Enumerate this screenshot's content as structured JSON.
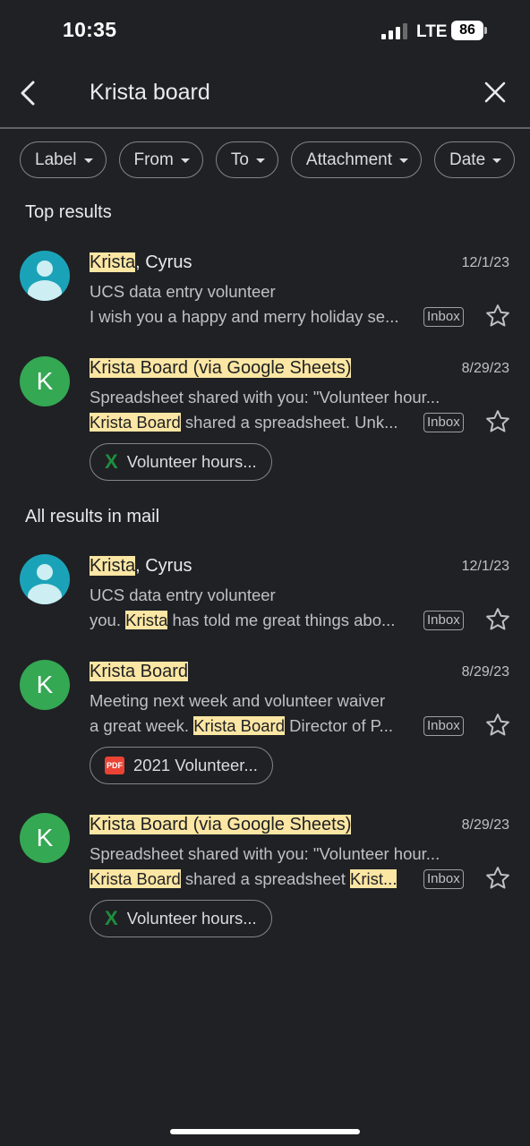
{
  "status_bar": {
    "time": "10:35",
    "network": "LTE",
    "battery": "86"
  },
  "search": {
    "query": "Krista board"
  },
  "filters": [
    "Label",
    "From",
    "To",
    "Attachment",
    "Date"
  ],
  "sections": {
    "top": "Top results",
    "all": "All results in mail"
  },
  "badge_label": "Inbox",
  "emails": [
    {
      "avatar": "person-icon",
      "sender": [
        {
          "t": "Krista",
          "h": true
        },
        {
          "t": ", Cyrus",
          "h": false
        }
      ],
      "date": "12/1/23",
      "subject": "UCS data entry volunteer",
      "snippet": [
        {
          "t": "I wish you a happy and merry holiday se...",
          "h": false
        }
      ]
    },
    {
      "avatar": "K",
      "sender": [
        {
          "t": "Krista Board (via Google Sheets)",
          "h": true
        }
      ],
      "date": "8/29/23",
      "subject": "Spreadsheet shared with you: \"Volunteer hour...",
      "snippet": [
        {
          "t": "Krista Board",
          "h": true
        },
        {
          "t": " shared a spreadsheet. Unk...",
          "h": false
        }
      ],
      "attachment": {
        "type": "sheets",
        "label": "Volunteer hours..."
      }
    },
    {
      "avatar": "person-icon",
      "sender": [
        {
          "t": "Krista",
          "h": true
        },
        {
          "t": ", Cyrus",
          "h": false
        }
      ],
      "date": "12/1/23",
      "subject": "UCS data entry volunteer",
      "snippet": [
        {
          "t": "you. ",
          "h": false
        },
        {
          "t": "Krista",
          "h": true
        },
        {
          "t": " has told me great things abo...",
          "h": false
        }
      ]
    },
    {
      "avatar": "K",
      "sender": [
        {
          "t": "Krista Board",
          "h": true
        }
      ],
      "date": "8/29/23",
      "subject": "Meeting next week and volunteer waiver",
      "snippet": [
        {
          "t": "a great week. ",
          "h": false
        },
        {
          "t": "Krista Board",
          "h": true
        },
        {
          "t": " Director of P...",
          "h": false
        }
      ],
      "attachment": {
        "type": "pdf",
        "label": "2021 Volunteer..."
      }
    },
    {
      "avatar": "K",
      "sender": [
        {
          "t": "Krista Board (via Google Sheets)",
          "h": true
        }
      ],
      "date": "8/29/23",
      "subject": "Spreadsheet shared with you: \"Volunteer hour...",
      "snippet": [
        {
          "t": "Krista Board",
          "h": true
        },
        {
          "t": " shared a spreadsheet ",
          "h": false
        },
        {
          "t": "Krist...",
          "h": true
        }
      ],
      "attachment": {
        "type": "sheets",
        "label": "Volunteer hours..."
      }
    }
  ],
  "colors": {
    "background": "#202124",
    "highlight": "#fbe6a3",
    "avatar_green": "#34a853",
    "avatar_teal": "#1aa3b8",
    "sheets_green": "#1e8e3e",
    "pdf_red": "#ea4335"
  }
}
